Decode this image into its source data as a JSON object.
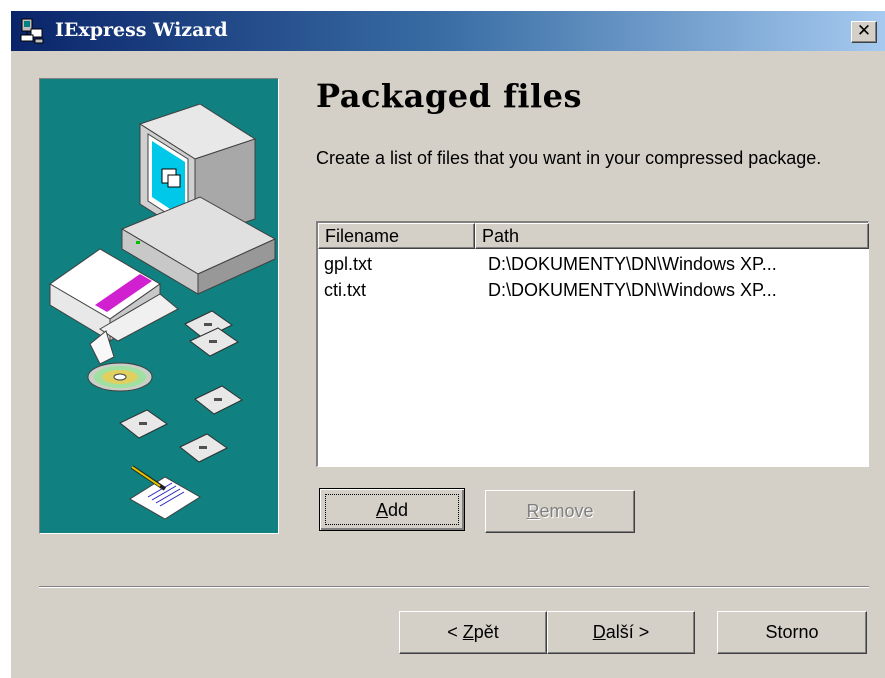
{
  "window": {
    "title": "IExpress Wizard",
    "close_glyph": "✕",
    "icon": "iexpress-app-icon"
  },
  "illustration": {
    "icon": "computer-with-files-illustration",
    "background_color": "#108080"
  },
  "page": {
    "title": "Packaged files",
    "description": "Create a list of files that you want in your compressed package."
  },
  "file_list": {
    "columns": [
      "Filename",
      "Path"
    ],
    "rows": [
      {
        "filename": "gpl.txt",
        "path": "D:\\DOKUMENTY\\DN\\Windows XP..."
      },
      {
        "filename": "cti.txt",
        "path": "D:\\DOKUMENTY\\DN\\Windows XP..."
      }
    ]
  },
  "list_buttons": {
    "add": {
      "mnemonic": "A",
      "rest": "dd"
    },
    "remove": {
      "mnemonic": "R",
      "rest": "emove",
      "enabled": false
    }
  },
  "nav_buttons": {
    "back": {
      "prefix": "< ",
      "mnemonic": "Z",
      "rest": "pět"
    },
    "next": {
      "mnemonic": "D",
      "rest": "alší >"
    },
    "cancel": {
      "label": "Storno"
    }
  },
  "colors": {
    "title_gradient_start": "#0a246a",
    "title_gradient_end": "#a6caf0",
    "dialog_face": "#d4d0c8"
  }
}
